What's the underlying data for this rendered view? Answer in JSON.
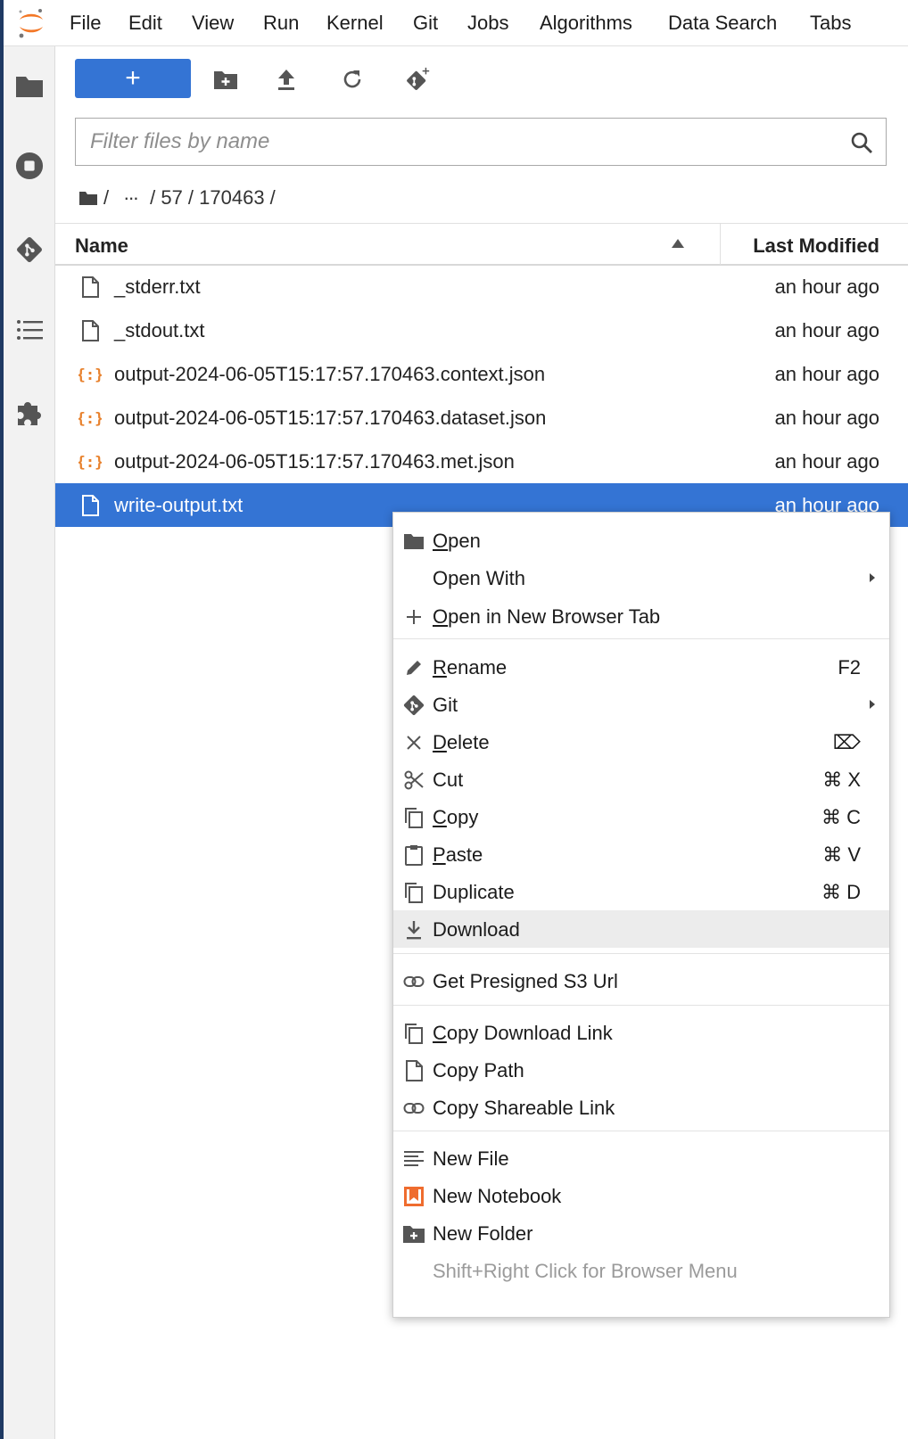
{
  "menubar": {
    "items": [
      "File",
      "Edit",
      "View",
      "Run",
      "Kernel",
      "Git",
      "Jobs",
      "Algorithms",
      "Data Search",
      "Tabs"
    ]
  },
  "activity_bar": {
    "icons": [
      "folder-icon",
      "stop-circle-icon",
      "git-icon",
      "list-icon",
      "extension-puzzle-icon"
    ]
  },
  "toolbar": {
    "new_label": "+",
    "icons": [
      "new-folder-icon",
      "upload-icon",
      "refresh-icon",
      "git-clone-icon"
    ]
  },
  "filter": {
    "placeholder": "Filter files by name",
    "value": ""
  },
  "breadcrumb": {
    "root_separator": "/",
    "ellipsis": "···",
    "path": "/ 57 / 170463 /"
  },
  "file_list": {
    "header": {
      "name": "Name",
      "modified": "Last Modified",
      "sort": "ascending"
    },
    "rows": [
      {
        "name": "_stderr.txt",
        "modified": "an hour ago",
        "icon": "file-icon"
      },
      {
        "name": "_stdout.txt",
        "modified": "an hour ago",
        "icon": "file-icon"
      },
      {
        "name": "output-2024-06-05T15:17:57.170463.context.json",
        "modified": "an hour ago",
        "icon": "json-icon"
      },
      {
        "name": "output-2024-06-05T15:17:57.170463.dataset.json",
        "modified": "an hour ago",
        "icon": "json-icon"
      },
      {
        "name": "output-2024-06-05T15:17:57.170463.met.json",
        "modified": "an hour ago",
        "icon": "json-icon"
      },
      {
        "name": "write-output.txt",
        "modified": "an hour ago",
        "icon": "file-icon",
        "selected": true
      }
    ]
  },
  "context_menu": {
    "items": [
      {
        "label": "Open",
        "mnemonic": "O",
        "rest": "pen",
        "icon": "folder-icon",
        "shortcut": ""
      },
      {
        "label": "Open With",
        "icon": "",
        "submenu": true
      },
      {
        "label": "Open in New Browser Tab",
        "mnemonic": "O",
        "rest": "pen in New Browser Tab",
        "icon": "plus-icon"
      },
      {
        "label": "Rename",
        "mnemonic": "R",
        "rest": "ename",
        "icon": "pencil-icon",
        "shortcut": "F2"
      },
      {
        "label": "Git",
        "icon": "git-icon",
        "submenu": true
      },
      {
        "label": "Delete",
        "mnemonic": "D",
        "rest": "elete",
        "icon": "close-icon",
        "shortcut": "⌦"
      },
      {
        "label": "Cut",
        "icon": "scissors-icon",
        "shortcut": "⌘ X"
      },
      {
        "label": "Copy",
        "mnemonic": "C",
        "rest": "opy",
        "icon": "copy-icon",
        "shortcut": "⌘ C"
      },
      {
        "label": "Paste",
        "mnemonic": "P",
        "rest": "aste",
        "icon": "paste-icon",
        "shortcut": "⌘ V"
      },
      {
        "label": "Duplicate",
        "icon": "copy-icon",
        "shortcut": "⌘ D"
      },
      {
        "label": "Download",
        "icon": "download-icon",
        "active": true
      },
      {
        "label": "Get Presigned S3 Url",
        "icon": "link-icon"
      },
      {
        "label": "Copy Download Link",
        "mnemonic": "C",
        "rest": "opy Download Link",
        "icon": "copy-icon"
      },
      {
        "label": "Copy Path",
        "icon": "file-icon"
      },
      {
        "label": "Copy Shareable Link",
        "icon": "link-icon"
      },
      {
        "label": "New File",
        "icon": "text-file-icon"
      },
      {
        "label": "New Notebook",
        "icon": "notebook-icon"
      },
      {
        "label": "New Folder",
        "icon": "new-folder-icon"
      },
      {
        "label": "Shift+Right Click for Browser Menu",
        "icon": "",
        "disabled": true
      }
    ]
  },
  "colors": {
    "accent": "#3474d4",
    "json_icon": "#e8822e",
    "logo": "#f37726",
    "notebook_icon": "#ef6c2e"
  }
}
